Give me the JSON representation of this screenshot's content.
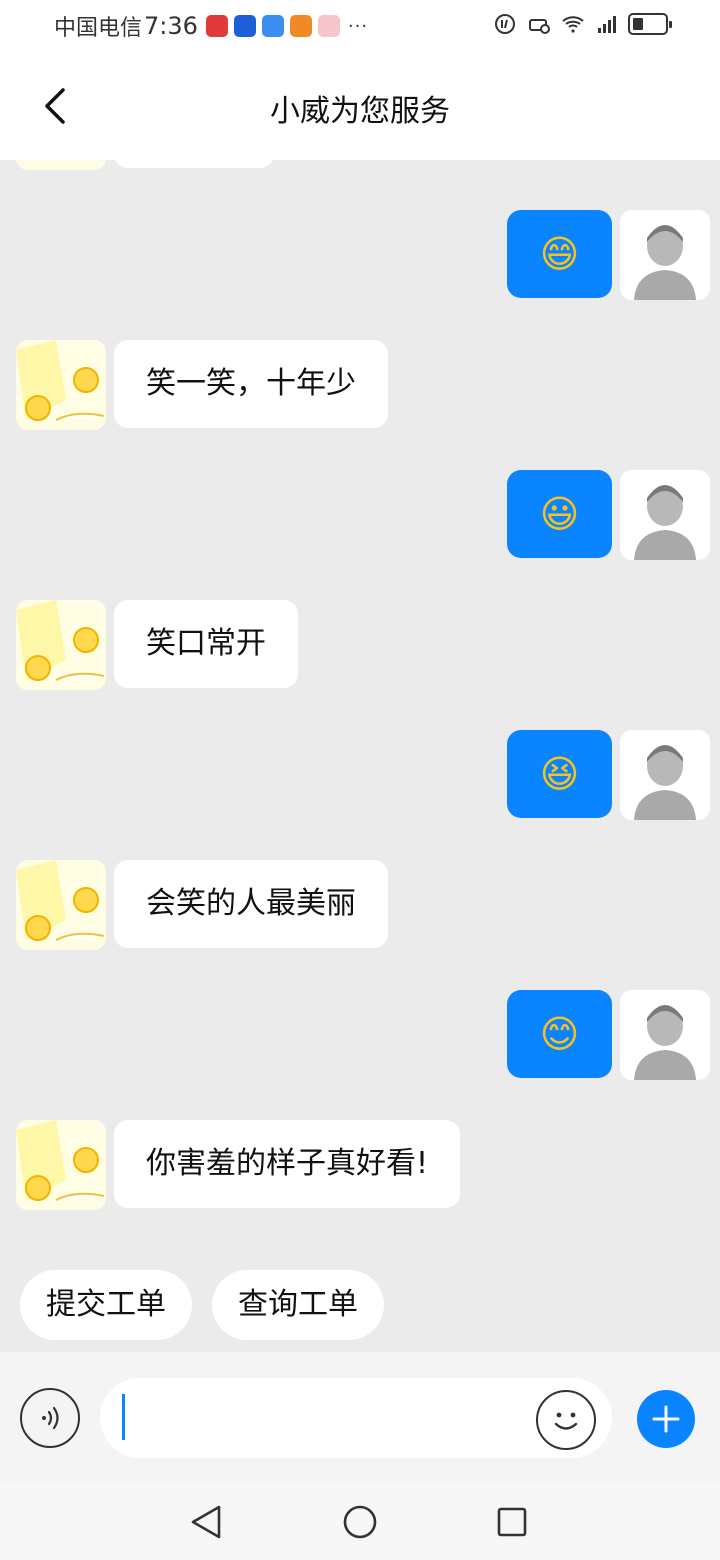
{
  "status_bar": {
    "carrier": "中国电信",
    "time": "7:36",
    "more": "···",
    "app_icons": [
      {
        "name": "huawei-store-icon",
        "color": "#e03a3a"
      },
      {
        "name": "bulb-app-icon",
        "color": "#1e5fd8"
      },
      {
        "name": "cloud-app-icon",
        "color": "#3b8ef0"
      },
      {
        "name": "video-app-icon",
        "color": "#f08a24"
      },
      {
        "name": "gift-app-icon",
        "color": "#e84b5a"
      }
    ]
  },
  "header": {
    "title": "小威为您服务"
  },
  "colors": {
    "accent": "#0a84ff",
    "background": "#ebebeb",
    "bubble_bot": "#ffffff"
  },
  "messages": [
    {
      "from": "user",
      "emoji": "😄",
      "icon": "grin-emoji"
    },
    {
      "from": "bot",
      "text": "笑一笑，十年少"
    },
    {
      "from": "user",
      "emoji": "😃",
      "icon": "smiley-emoji"
    },
    {
      "from": "bot",
      "text": "笑口常开"
    },
    {
      "from": "user",
      "emoji": "😆",
      "icon": "laughing-emoji"
    },
    {
      "from": "bot",
      "text": "会笑的人最美丽"
    },
    {
      "from": "user",
      "emoji": "😊",
      "icon": "blush-emoji"
    },
    {
      "from": "bot",
      "text": "你害羞的样子真好看!"
    }
  ],
  "quick_actions": {
    "submit_ticket": "提交工单",
    "query_ticket": "查询工单"
  },
  "input_bar": {
    "placeholder": ""
  }
}
